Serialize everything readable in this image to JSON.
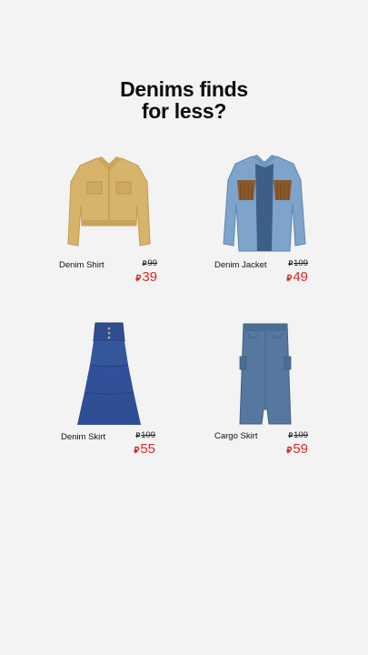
{
  "headline": {
    "line1": "Denims finds",
    "line2": "for less?"
  },
  "currency_symbol": "⃁",
  "products": [
    {
      "name": "Denim Shirt",
      "old_price": "99",
      "new_price": "39",
      "image": "tan-cropped-shirt-jacket"
    },
    {
      "name": "Denim Jacket",
      "old_price": "109",
      "new_price": "49",
      "image": "denim-fringe-jacket"
    },
    {
      "name": "Denim Skirt",
      "old_price": "109",
      "new_price": "55",
      "image": "tiered-denim-maxi-skirt"
    },
    {
      "name": "Cargo Skirt",
      "old_price": "109",
      "new_price": "59",
      "image": "denim-cargo-skirt"
    }
  ],
  "colors": {
    "background": "#f3f3f3",
    "sale_price": "#d62b2b",
    "headline": "#0d0d0d"
  }
}
